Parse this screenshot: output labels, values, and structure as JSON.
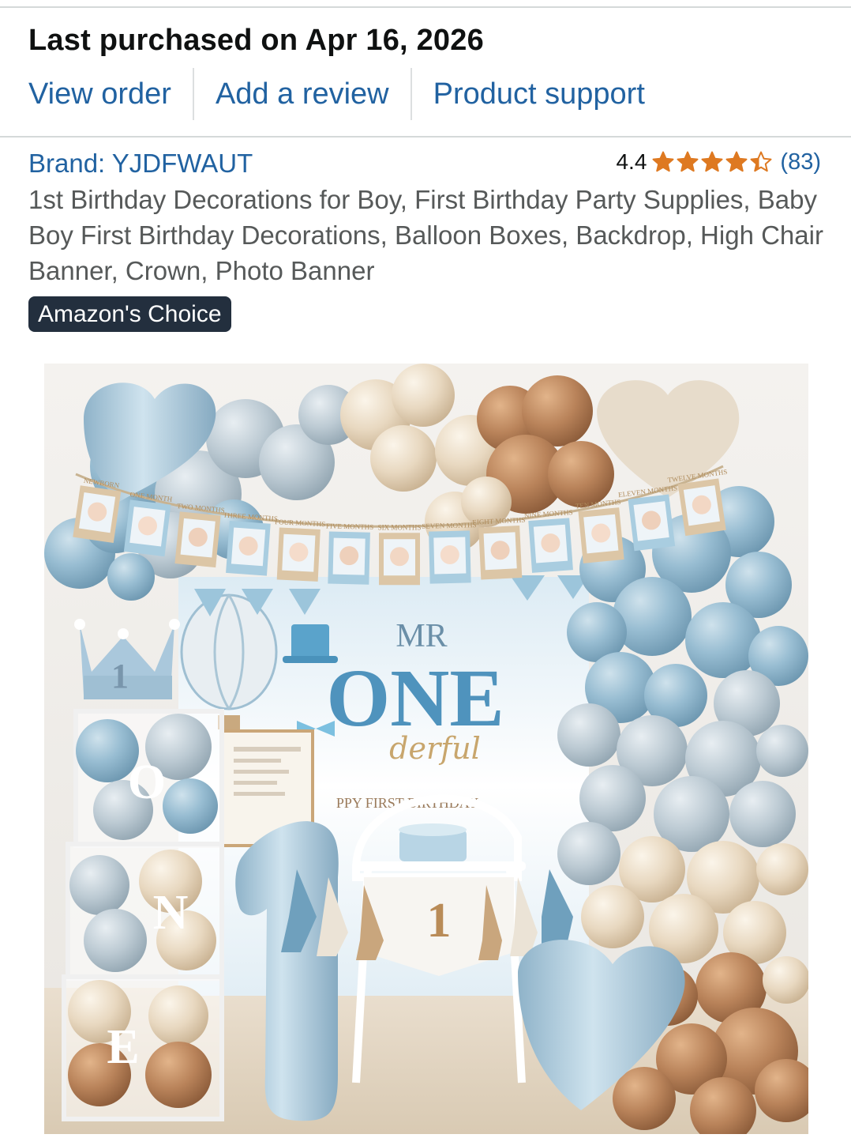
{
  "purchase": {
    "heading": "Last purchased on Apr 16, 2026"
  },
  "actions": {
    "view_order": "View order",
    "add_review": "Add a review",
    "product_support": "Product support"
  },
  "product": {
    "brand": "Brand: YJDFWAUT",
    "rating_value": "4.4",
    "rating_stars": 4.4,
    "rating_count": "(83)",
    "title": "1st Birthday Decorations for Boy, First Birthday Party Supplies, Baby Boy First Birthday Decorations, Balloon Boxes, Backdrop, High Chair Banner, Crown, Photo Banner",
    "badge": "Amazon's Choice"
  },
  "image": {
    "backdrop_title": "MR",
    "backdrop_main": "ONE",
    "backdrop_sub": "derful",
    "backdrop_banner": "PPY FIRST BIRTHDAY",
    "box_letters": [
      "O",
      "N",
      "E"
    ],
    "crown_number": "1",
    "high_chair_number": "1",
    "month_labels": [
      "NEWBORN",
      "ONE MONTH",
      "TWO MONTHS",
      "THREE MONTHS",
      "FOUR MONTHS",
      "FIVE MONTHS",
      "SIX MONTHS",
      "SEVEN MONTHS",
      "EIGHT MONTHS",
      "NINE MONTHS",
      "TEN MONTHS",
      "ELEVEN MONTHS",
      "TWELVE MONTHS"
    ]
  },
  "colors": {
    "link": "#2162a1",
    "star": "#de7921",
    "badge_bg": "#232f3e",
    "balloon_blue": "#8fb6cc",
    "balloon_cream": "#e6d6bf",
    "balloon_brown": "#b9835a"
  }
}
